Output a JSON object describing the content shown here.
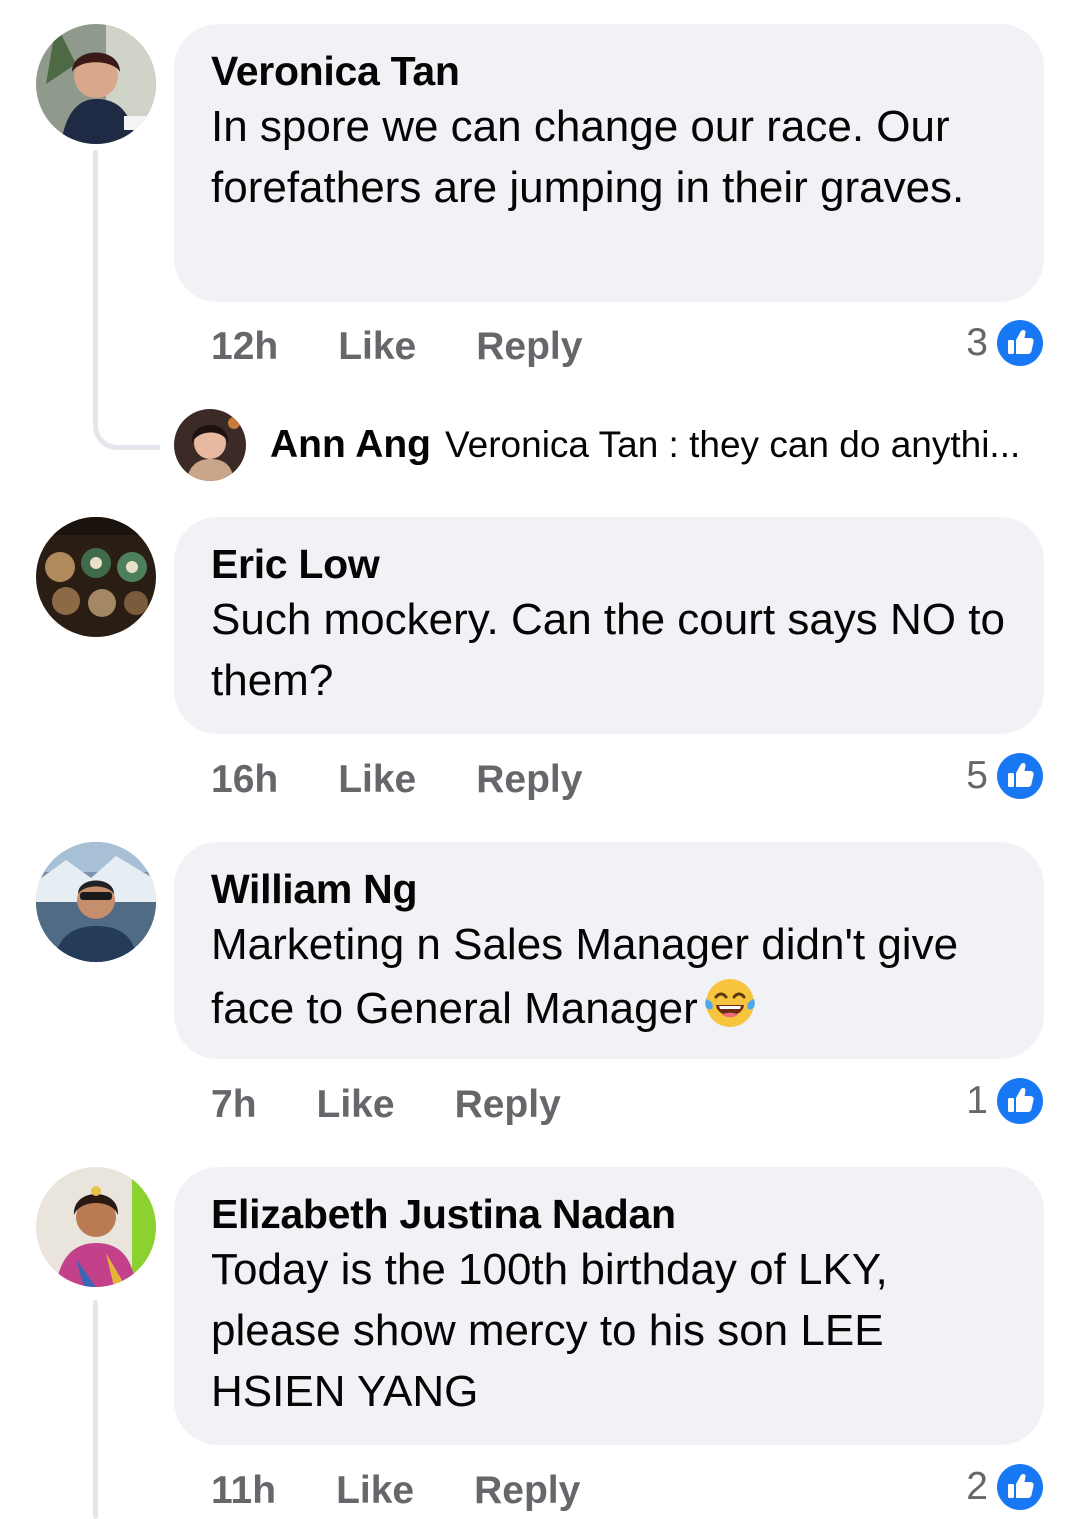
{
  "colors": {
    "bubble": "#f0f2f5",
    "meta_text": "#65676b",
    "like_blue": "#1877f2",
    "thread_line": "#e4e6eb"
  },
  "icons": {
    "reaction": "like-thumbs-up-icon",
    "emoji": "laughing-tears-emoji-icon"
  },
  "comments": [
    {
      "author": "Veronica Tan",
      "text": "In spore we can change our race. Our forefathers are jumping in their graves.",
      "time": "12h",
      "like_label": "Like",
      "reply_label": "Reply",
      "reactions": "3",
      "reply_preview": {
        "author": "Ann Ang",
        "text": "Veronica Tan : they can do anythi..."
      }
    },
    {
      "author": "Eric Low",
      "text": "Such mockery. Can the court says NO to them?",
      "time": "16h",
      "like_label": "Like",
      "reply_label": "Reply",
      "reactions": "5"
    },
    {
      "author": "William Ng",
      "text": "Marketing n Sales Manager didn't give face to General Manager",
      "time": "7h",
      "like_label": "Like",
      "reply_label": "Reply",
      "reactions": "1"
    },
    {
      "author": "Elizabeth Justina Nadan",
      "text": "Today is the 100th birthday of LKY, please show mercy to his son LEE HSIEN YANG",
      "time": "11h",
      "like_label": "Like",
      "reply_label": "Reply",
      "reactions": "2"
    }
  ]
}
